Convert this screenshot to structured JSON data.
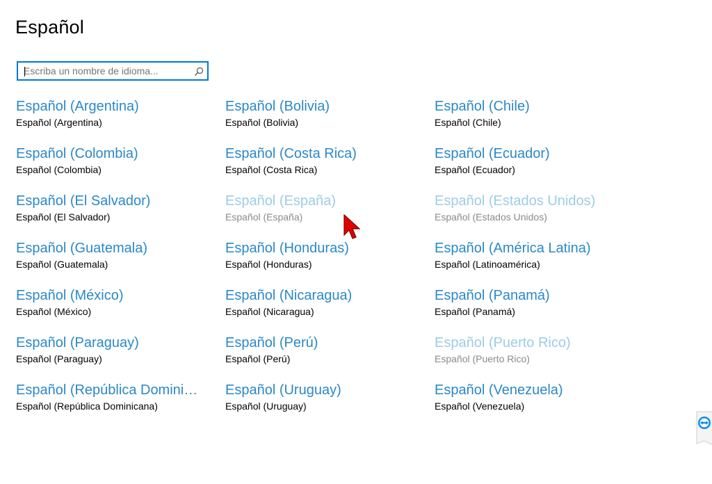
{
  "page": {
    "title": "Español"
  },
  "search": {
    "placeholder": "Escriba un nombre de idioma..."
  },
  "languages": [
    {
      "name": "Español (Argentina)",
      "native": "Español (Argentina)",
      "disabled": false
    },
    {
      "name": "Español (Bolivia)",
      "native": "Español (Bolivia)",
      "disabled": false
    },
    {
      "name": "Español (Chile)",
      "native": "Español (Chile)",
      "disabled": false
    },
    {
      "name": "Español (Colombia)",
      "native": "Español (Colombia)",
      "disabled": false
    },
    {
      "name": "Español (Costa Rica)",
      "native": "Español (Costa Rica)",
      "disabled": false
    },
    {
      "name": "Español (Ecuador)",
      "native": "Español (Ecuador)",
      "disabled": false
    },
    {
      "name": "Español (El Salvador)",
      "native": "Español (El Salvador)",
      "disabled": false
    },
    {
      "name": "Español (España)",
      "native": "Español (España)",
      "disabled": true
    },
    {
      "name": "Español (Estados Unidos)",
      "native": "Español (Estados Unidos)",
      "disabled": true
    },
    {
      "name": "Español (Guatemala)",
      "native": "Español (Guatemala)",
      "disabled": false
    },
    {
      "name": "Español (Honduras)",
      "native": "Español (Honduras)",
      "disabled": false
    },
    {
      "name": "Español (América Latina)",
      "native": "Español (Latinoamérica)",
      "disabled": false
    },
    {
      "name": "Español (México)",
      "native": "Español (México)",
      "disabled": false
    },
    {
      "name": "Español (Nicaragua)",
      "native": "Español (Nicaragua)",
      "disabled": false
    },
    {
      "name": "Español (Panamá)",
      "native": "Español (Panamá)",
      "disabled": false
    },
    {
      "name": "Español (Paraguay)",
      "native": "Español (Paraguay)",
      "disabled": false
    },
    {
      "name": "Español (Perú)",
      "native": "Español (Perú)",
      "disabled": false
    },
    {
      "name": "Español (Puerto Rico)",
      "native": "Español (Puerto Rico)",
      "disabled": true
    },
    {
      "name": "Español (República Dominicana)",
      "native": "Español (República Dominicana)",
      "disabled": false
    },
    {
      "name": "Español (Uruguay)",
      "native": "Español (Uruguay)",
      "disabled": false
    },
    {
      "name": "Español (Venezuela)",
      "native": "Español (Venezuela)",
      "disabled": false
    }
  ],
  "colors": {
    "accent": "#0078d7",
    "link": "#2b88c8",
    "link_disabled": "#9dcce6"
  },
  "icons": {
    "search": "search-icon",
    "cursor": "mouse-pointer-icon",
    "teamviewer": "teamviewer-icon"
  }
}
